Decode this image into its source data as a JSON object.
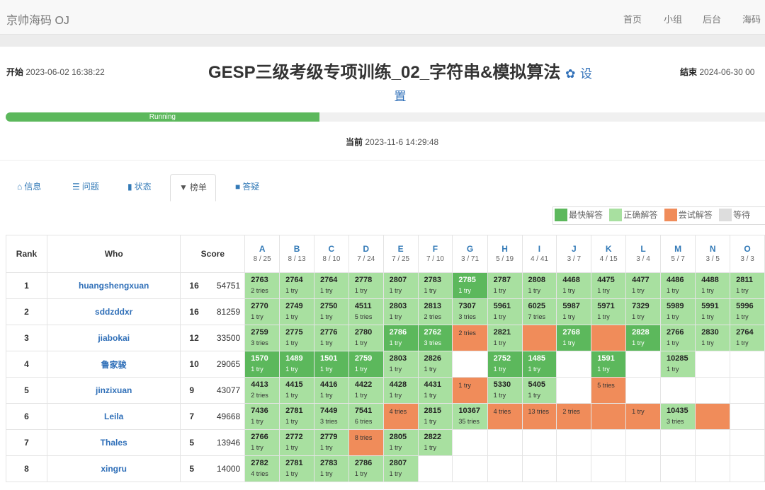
{
  "nav": {
    "brand": "京帅海码 OJ",
    "links": [
      "首页",
      "小组",
      "后台",
      "海码"
    ]
  },
  "contest": {
    "start_label": "开始",
    "start_time": "2023-06-02 16:38:22",
    "end_label": "结束",
    "end_time": "2024-06-30 00",
    "title": "GESP三级考级专项训练_02_字符串&模拟算法",
    "settings_label": "设置",
    "status": "Running",
    "progress": 0.413,
    "current_label": "当前",
    "current_time": "2023-11-6 14:29:48"
  },
  "tabs": [
    {
      "icon": "⌂",
      "label": "信息"
    },
    {
      "icon": "☰",
      "label": "问题"
    },
    {
      "icon": "▮",
      "label": "状态"
    },
    {
      "icon": "▼",
      "label": "榜单"
    },
    {
      "icon": "■",
      "label": "答疑"
    }
  ],
  "legend": [
    {
      "label": "最快解答",
      "color": "#5cb85c"
    },
    {
      "label": "正确解答",
      "color": "#a8e0a0"
    },
    {
      "label": "尝试解答",
      "color": "#f08c5a"
    },
    {
      "label": "等待",
      "color": "#dddddd"
    }
  ],
  "headers": {
    "rank": "Rank",
    "who": "Who",
    "score": "Score"
  },
  "problems": [
    {
      "id": "A",
      "ratio": "8 / 25"
    },
    {
      "id": "B",
      "ratio": "8 / 13"
    },
    {
      "id": "C",
      "ratio": "8 / 10"
    },
    {
      "id": "D",
      "ratio": "7 / 24"
    },
    {
      "id": "E",
      "ratio": "7 / 25"
    },
    {
      "id": "F",
      "ratio": "7 / 10"
    },
    {
      "id": "G",
      "ratio": "3 / 71"
    },
    {
      "id": "H",
      "ratio": "5 / 19"
    },
    {
      "id": "I",
      "ratio": "4 / 41"
    },
    {
      "id": "J",
      "ratio": "3 / 7"
    },
    {
      "id": "K",
      "ratio": "4 / 15"
    },
    {
      "id": "L",
      "ratio": "3 / 4"
    },
    {
      "id": "M",
      "ratio": "5 / 7"
    },
    {
      "id": "N",
      "ratio": "3 / 5"
    },
    {
      "id": "O",
      "ratio": "3 / 3"
    }
  ],
  "rows": [
    {
      "rank": "1",
      "who": "huangshengxuan",
      "solved": "16",
      "penalty": "54751",
      "cells": [
        [
          "ok",
          "2763",
          "2 tries"
        ],
        [
          "ok",
          "2764",
          "1 try"
        ],
        [
          "ok",
          "2764",
          "1 try"
        ],
        [
          "ok",
          "2778",
          "1 try"
        ],
        [
          "ok",
          "2807",
          "1 try"
        ],
        [
          "ok",
          "2783",
          "1 try"
        ],
        [
          "fast",
          "2785",
          "1 try"
        ],
        [
          "ok",
          "2787",
          "1 try"
        ],
        [
          "ok",
          "2808",
          "1 try"
        ],
        [
          "ok",
          "4468",
          "1 try"
        ],
        [
          "ok",
          "4475",
          "1 try"
        ],
        [
          "ok",
          "4477",
          "1 try"
        ],
        [
          "ok",
          "4486",
          "1 try"
        ],
        [
          "ok",
          "4488",
          "1 try"
        ],
        [
          "ok",
          "2811",
          "1 try"
        ]
      ]
    },
    {
      "rank": "2",
      "who": "sddzddxr",
      "solved": "16",
      "penalty": "81259",
      "cells": [
        [
          "ok",
          "2770",
          "1 try"
        ],
        [
          "ok",
          "2749",
          "1 try"
        ],
        [
          "ok",
          "2750",
          "1 try"
        ],
        [
          "ok",
          "4511",
          "5 tries"
        ],
        [
          "ok",
          "2803",
          "1 try"
        ],
        [
          "ok",
          "2813",
          "2 tries"
        ],
        [
          "ok",
          "7307",
          "3 tries"
        ],
        [
          "ok",
          "5961",
          "1 try"
        ],
        [
          "ok",
          "6025",
          "7 tries"
        ],
        [
          "ok",
          "5987",
          "1 try"
        ],
        [
          "ok",
          "5971",
          "1 try"
        ],
        [
          "ok",
          "7329",
          "1 try"
        ],
        [
          "ok",
          "5989",
          "1 try"
        ],
        [
          "ok",
          "5991",
          "1 try"
        ],
        [
          "ok",
          "5996",
          "1 try"
        ]
      ]
    },
    {
      "rank": "3",
      "who": "jiabokai",
      "solved": "12",
      "penalty": "33500",
      "cells": [
        [
          "ok",
          "2759",
          "3 tries"
        ],
        [
          "ok",
          "2775",
          "1 try"
        ],
        [
          "ok",
          "2776",
          "1 try"
        ],
        [
          "ok",
          "2780",
          "1 try"
        ],
        [
          "fast",
          "2786",
          "1 try"
        ],
        [
          "fast",
          "2762",
          "3 tries"
        ],
        [
          "bad",
          "",
          "2 tries"
        ],
        [
          "ok",
          "2821",
          "1 try"
        ],
        [
          "bad",
          "",
          ""
        ],
        [
          "fast",
          "2768",
          "1 try"
        ],
        [
          "bad",
          "",
          ""
        ],
        [
          "fast",
          "2828",
          "1 try"
        ],
        [
          "ok",
          "2766",
          "1 try"
        ],
        [
          "ok",
          "2830",
          "1 try"
        ],
        [
          "ok",
          "2764",
          "1 try"
        ]
      ]
    },
    {
      "rank": "4",
      "who": "鲁家骏",
      "solved": "10",
      "penalty": "29065",
      "cells": [
        [
          "fast",
          "1570",
          "1 try"
        ],
        [
          "fast",
          "1489",
          "1 try"
        ],
        [
          "fast",
          "1501",
          "1 try"
        ],
        [
          "fast",
          "2759",
          "1 try"
        ],
        [
          "ok",
          "2803",
          "1 try"
        ],
        [
          "ok",
          "2826",
          "1 try"
        ],
        [
          "none",
          "",
          ""
        ],
        [
          "fast",
          "2752",
          "1 try"
        ],
        [
          "fast",
          "1485",
          "1 try"
        ],
        [
          "none",
          "",
          ""
        ],
        [
          "fast",
          "1591",
          "1 try"
        ],
        [
          "none",
          "",
          ""
        ],
        [
          "ok",
          "10285",
          "1 try"
        ],
        [
          "none",
          "",
          ""
        ],
        [
          "none",
          "",
          ""
        ]
      ]
    },
    {
      "rank": "5",
      "who": "jinzixuan",
      "solved": "9",
      "penalty": "43077",
      "cells": [
        [
          "ok",
          "4413",
          "2 tries"
        ],
        [
          "ok",
          "4415",
          "1 try"
        ],
        [
          "ok",
          "4416",
          "1 try"
        ],
        [
          "ok",
          "4422",
          "1 try"
        ],
        [
          "ok",
          "4428",
          "1 try"
        ],
        [
          "ok",
          "4431",
          "1 try"
        ],
        [
          "bad",
          "",
          "1 try"
        ],
        [
          "ok",
          "5330",
          "1 try"
        ],
        [
          "ok",
          "5405",
          "1 try"
        ],
        [
          "none",
          "",
          ""
        ],
        [
          "bad",
          "",
          "5 tries"
        ],
        [
          "none",
          "",
          ""
        ],
        [
          "none",
          "",
          ""
        ],
        [
          "none",
          "",
          ""
        ],
        [
          "none",
          "",
          ""
        ]
      ]
    },
    {
      "rank": "6",
      "who": "Leila",
      "solved": "7",
      "penalty": "49668",
      "cells": [
        [
          "ok",
          "7436",
          "1 try"
        ],
        [
          "ok",
          "2781",
          "1 try"
        ],
        [
          "ok",
          "7449",
          "3 tries"
        ],
        [
          "ok",
          "7541",
          "6 tries"
        ],
        [
          "bad",
          "",
          "4 tries"
        ],
        [
          "ok",
          "2815",
          "1 try"
        ],
        [
          "ok",
          "10367",
          "35 tries"
        ],
        [
          "bad",
          "",
          "4 tries"
        ],
        [
          "bad",
          "",
          "13 tries"
        ],
        [
          "bad",
          "",
          "2 tries"
        ],
        [
          "bad",
          "",
          ""
        ],
        [
          "bad",
          "",
          "1 try"
        ],
        [
          "ok",
          "10435",
          "3 tries"
        ],
        [
          "bad",
          "",
          ""
        ],
        [
          "none",
          "",
          ""
        ]
      ]
    },
    {
      "rank": "7",
      "who": "Thales",
      "solved": "5",
      "penalty": "13946",
      "cells": [
        [
          "ok",
          "2766",
          "1 try"
        ],
        [
          "ok",
          "2772",
          "1 try"
        ],
        [
          "ok",
          "2779",
          "1 try"
        ],
        [
          "bad",
          "",
          "8 tries"
        ],
        [
          "ok",
          "2805",
          "1 try"
        ],
        [
          "ok",
          "2822",
          "1 try"
        ],
        [
          "none",
          "",
          ""
        ],
        [
          "none",
          "",
          ""
        ],
        [
          "none",
          "",
          ""
        ],
        [
          "none",
          "",
          ""
        ],
        [
          "none",
          "",
          ""
        ],
        [
          "none",
          "",
          ""
        ],
        [
          "none",
          "",
          ""
        ],
        [
          "none",
          "",
          ""
        ],
        [
          "none",
          "",
          ""
        ]
      ]
    },
    {
      "rank": "8",
      "who": "xingru",
      "solved": "5",
      "penalty": "14000",
      "cells": [
        [
          "ok",
          "2782",
          "4 tries"
        ],
        [
          "ok",
          "2781",
          "1 try"
        ],
        [
          "ok",
          "2783",
          "1 try"
        ],
        [
          "ok",
          "2786",
          "1 try"
        ],
        [
          "ok",
          "2807",
          "1 try"
        ],
        [
          "none",
          "",
          ""
        ],
        [
          "none",
          "",
          ""
        ],
        [
          "none",
          "",
          ""
        ],
        [
          "none",
          "",
          ""
        ],
        [
          "none",
          "",
          ""
        ],
        [
          "none",
          "",
          ""
        ],
        [
          "none",
          "",
          ""
        ],
        [
          "none",
          "",
          ""
        ],
        [
          "none",
          "",
          ""
        ],
        [
          "none",
          "",
          ""
        ]
      ]
    }
  ]
}
